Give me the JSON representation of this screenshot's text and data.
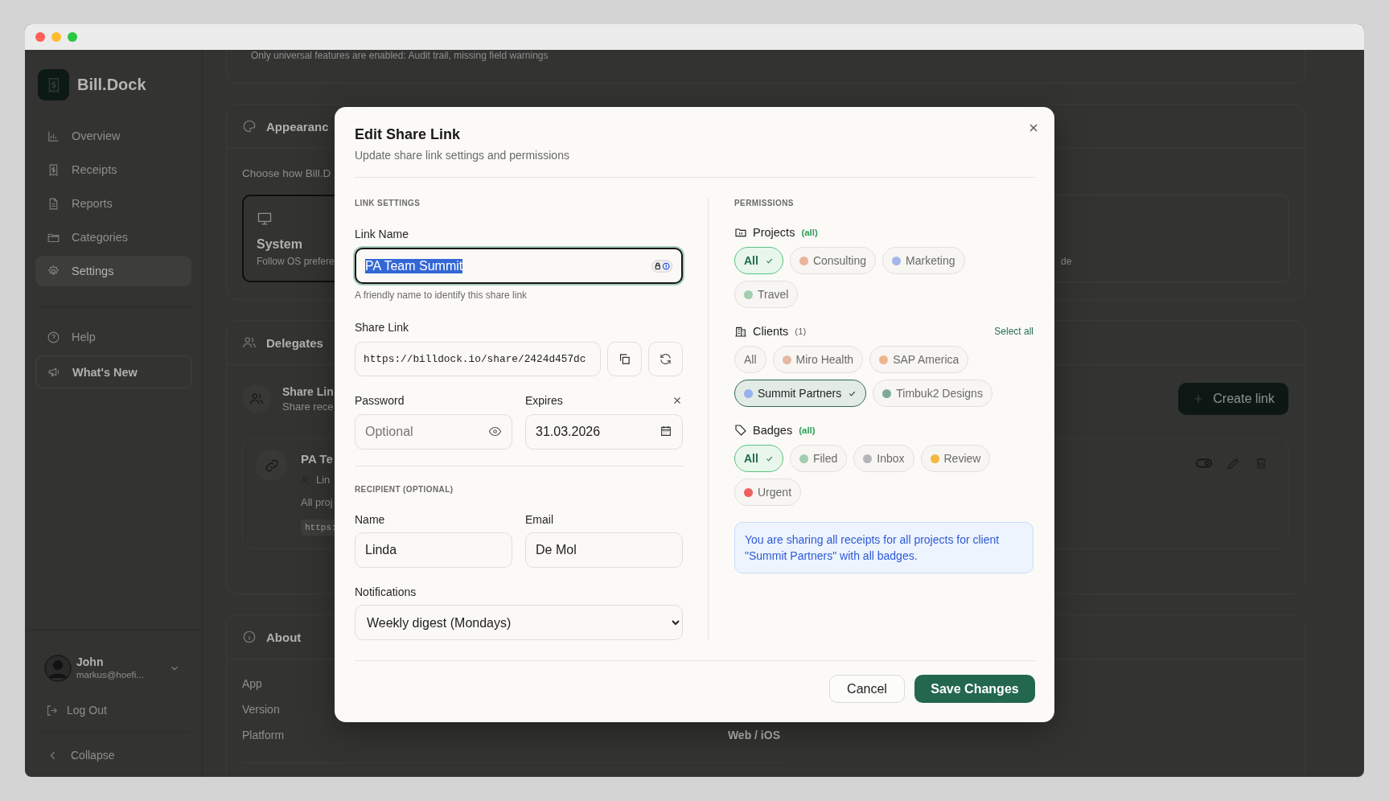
{
  "sidebar": {
    "brand": "Bill.Dock",
    "nav": [
      {
        "label": "Overview",
        "selected": false
      },
      {
        "label": "Receipts",
        "selected": false
      },
      {
        "label": "Reports",
        "selected": false
      },
      {
        "label": "Categories",
        "selected": false
      },
      {
        "label": "Settings",
        "selected": true
      }
    ],
    "extra": [
      {
        "label": "Help",
        "kind": "plain"
      },
      {
        "label": "What's New",
        "kind": "outlined"
      }
    ],
    "user": {
      "name": "John",
      "email": "markus@hoefi..."
    },
    "logout": "Log Out",
    "collapse": "Collapse"
  },
  "main": {
    "notice": "Only universal features are enabled: Audit trail, missing field warnings",
    "appearance": {
      "title": "Appearanc",
      "description": "Choose how Bill.D",
      "options": [
        {
          "title": "System",
          "description": "Follow OS prefere",
          "selected": true
        },
        {
          "description": "de",
          "selected": false
        }
      ]
    },
    "delegates": {
      "title": "Delegates",
      "share": {
        "title": "Share Lin",
        "description": "Share rece"
      },
      "create_label": "Create link",
      "links": [
        {
          "name": "PA Te",
          "recipient": "Lin",
          "scope": "All proj",
          "url": "https:"
        }
      ]
    },
    "about": {
      "title": "About",
      "rows": [
        {
          "label": "App"
        },
        {
          "label": "Version"
        },
        {
          "label": "Platform",
          "value": "Web / iOS"
        }
      ]
    }
  },
  "dialog": {
    "title": "Edit Share Link",
    "subtitle": "Update share link settings and permissions",
    "link_settings": {
      "heading": "LINK SETTINGS",
      "link_name": {
        "label": "Link Name",
        "value": "PA Team Summit",
        "focused": true,
        "text_selected": true,
        "hint": "A friendly name to identify this share link"
      },
      "share_link": {
        "label": "Share Link",
        "value": "https://billdock.io/share/2424d457dc"
      },
      "password": {
        "label": "Password",
        "placeholder": "Optional"
      },
      "expires": {
        "label": "Expires",
        "value": "31.03.2026"
      }
    },
    "recipient": {
      "heading": "RECIPIENT (OPTIONAL)",
      "name": {
        "label": "Name",
        "value": "Linda"
      },
      "email": {
        "label": "Email",
        "value": "De Mol"
      }
    },
    "notifications": {
      "label": "Notifications",
      "value": "Weekly digest (Mondays)"
    },
    "permissions": {
      "heading": "PERMISSIONS",
      "groups": [
        {
          "title": "Projects",
          "count": "(all)",
          "count_highlighted": true,
          "chips": [
            {
              "label": "All",
              "selected": true
            },
            {
              "label": "Consulting",
              "color": "#e9b39b",
              "selected": false
            },
            {
              "label": "Marketing",
              "color": "#a3b6ea",
              "selected": false
            },
            {
              "label": "Travel",
              "color": "#a2cdb0",
              "selected": false
            }
          ]
        },
        {
          "title": "Clients",
          "count": "(1)",
          "count_highlighted": false,
          "action": "Select all",
          "chips": [
            {
              "label": "All",
              "selected": false
            },
            {
              "label": "Miro Health",
              "color": "#e7b8a3",
              "selected": false
            },
            {
              "label": "SAP America",
              "color": "#efb48f",
              "selected": false
            },
            {
              "label": "Summit Partners",
              "color": "#97b1f0",
              "selected": true
            },
            {
              "label": "Timbuk2 Designs",
              "color": "#7eab97",
              "selected": false
            }
          ]
        },
        {
          "title": "Badges",
          "count": "(all)",
          "count_highlighted": true,
          "chips": [
            {
              "label": "All",
              "selected": true
            },
            {
              "label": "Filed",
              "color": "#a2cdb0",
              "selected": false
            },
            {
              "label": "Inbox",
              "color": "#b3b5b9",
              "selected": false
            },
            {
              "label": "Review",
              "color": "#f5b73f",
              "selected": false
            },
            {
              "label": "Urgent",
              "color": "#ef5f5f",
              "selected": false
            }
          ]
        }
      ],
      "summary": "You are sharing all receipts for all projects for client \"Summit Partners\" with all badges."
    },
    "buttons": {
      "cancel": "Cancel",
      "save": "Save Changes"
    }
  }
}
